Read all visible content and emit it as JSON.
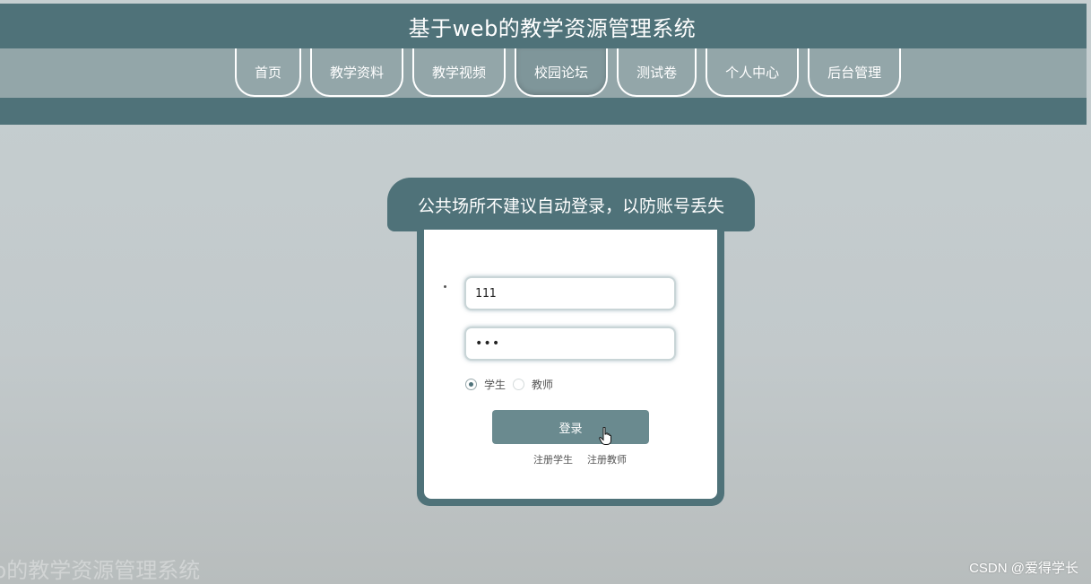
{
  "header": {
    "title": "基于web的教学资源管理系统"
  },
  "nav": {
    "items": [
      {
        "label": "首页"
      },
      {
        "label": "教学资料"
      },
      {
        "label": "教学视频"
      },
      {
        "label": "校园论坛",
        "active": true
      },
      {
        "label": "测试卷"
      },
      {
        "label": "个人中心"
      },
      {
        "label": "后台管理"
      }
    ]
  },
  "login": {
    "banner": "公共场所不建议自动登录，以防账号丢失",
    "username_value": "111",
    "password_value": "•••",
    "roles": [
      {
        "label": "学生",
        "checked": true
      },
      {
        "label": "教师",
        "checked": false
      }
    ],
    "submit_label": "登录",
    "register_student": "注册学生",
    "register_teacher": "注册教师"
  },
  "footer": {
    "faded_title": "b的教学资源管理系统",
    "watermark": "CSDN @爱得学长"
  },
  "colors": {
    "primary": "#4f7279",
    "nav_bg": "#93a6a9",
    "button": "#6a8a8f"
  }
}
